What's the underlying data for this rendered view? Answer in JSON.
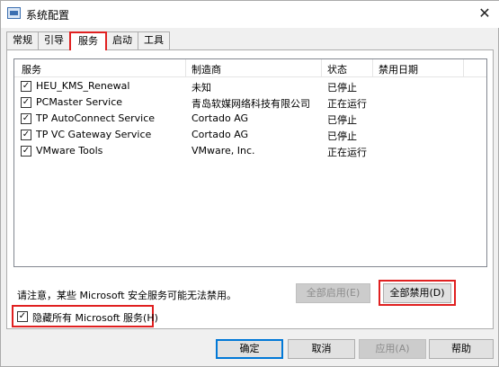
{
  "window": {
    "title": "系统配置",
    "close_glyph": "✕"
  },
  "tabs": [
    {
      "label": "常规"
    },
    {
      "label": "引导"
    },
    {
      "label": "服务"
    },
    {
      "label": "启动"
    },
    {
      "label": "工具"
    }
  ],
  "active_tab": "服务",
  "table": {
    "headers": [
      "服务",
      "制造商",
      "状态",
      "禁用日期"
    ],
    "rows": [
      {
        "checked": true,
        "service": "HEU_KMS_Renewal",
        "maker": "未知",
        "status": "已停止",
        "date": ""
      },
      {
        "checked": true,
        "service": "PCMaster Service",
        "maker": "青岛软媒网络科技有限公司",
        "status": "正在运行",
        "date": ""
      },
      {
        "checked": true,
        "service": "TP AutoConnect Service",
        "maker": "Cortado AG",
        "status": "已停止",
        "date": ""
      },
      {
        "checked": true,
        "service": "TP VC Gateway Service",
        "maker": "Cortado AG",
        "status": "已停止",
        "date": ""
      },
      {
        "checked": true,
        "service": "VMware Tools",
        "maker": "VMware, Inc.",
        "status": "正在运行",
        "date": ""
      }
    ]
  },
  "note": "请注意，某些 Microsoft 安全服务可能无法禁用。",
  "buttons": {
    "enable_all": "全部启用(E)",
    "disable_all": "全部禁用(D)",
    "ok": "确定",
    "cancel": "取消",
    "apply": "应用(A)",
    "help": "帮助"
  },
  "hide_ms": {
    "checked": true,
    "label": "隐藏所有 Microsoft 服务(H)"
  },
  "check_glyph": "✓",
  "colors": {
    "highlight_frame": "#e02020",
    "default_button_border": "#0078d7"
  }
}
